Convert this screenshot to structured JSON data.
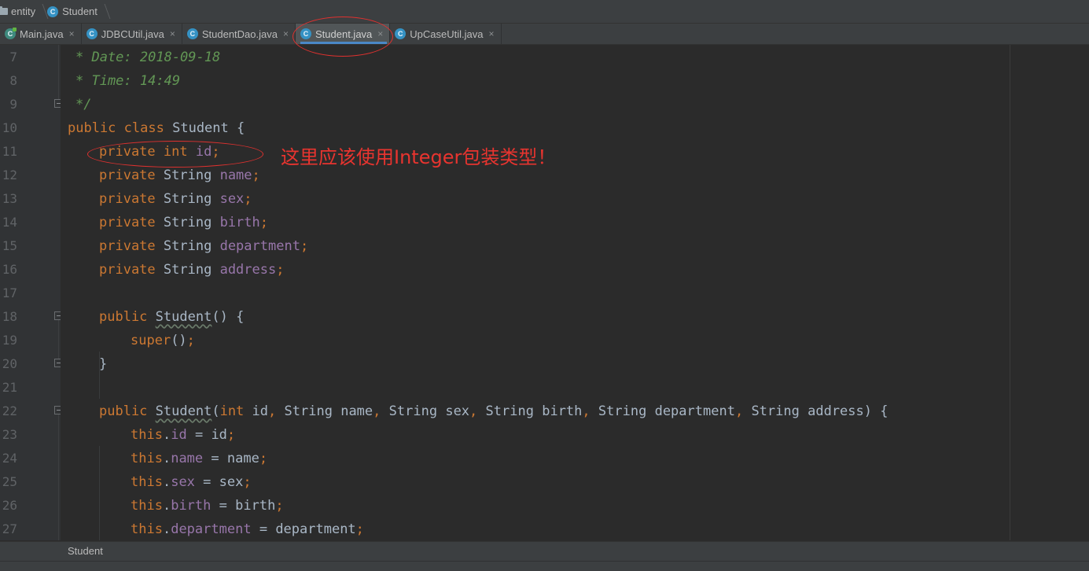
{
  "breadcrumb": {
    "folder": "entity",
    "file": "Student"
  },
  "tabs": [
    {
      "label": "Main.java"
    },
    {
      "label": "JDBCUtil.java"
    },
    {
      "label": "StudentDao.java"
    },
    {
      "label": "Student.java"
    },
    {
      "label": "UpCaseUtil.java"
    }
  ],
  "tab_close": "×",
  "icon_letter": "C",
  "line_numbers": [
    "7",
    "8",
    "9",
    "10",
    "11",
    "12",
    "13",
    "14",
    "15",
    "16",
    "17",
    "18",
    "19",
    "20",
    "21",
    "22",
    "23",
    "24",
    "25",
    "26",
    "27"
  ],
  "code": {
    "l7": "* Date: 2018-09-18",
    "l8": "* Time: 14:49",
    "l9": "*/",
    "public": "public",
    "class": "class",
    "private": "private",
    "int": "int",
    "String": "String",
    "super": "super",
    "this": "this",
    "class_name": "Student",
    "fields": [
      "id",
      "name",
      "sex",
      "birth",
      "department",
      "address"
    ],
    "params": [
      "id",
      "name",
      "sex",
      "birth",
      "department",
      "address"
    ],
    "open_brace": "{",
    "close_brace": "}",
    "semicolon": ";",
    "dot": ".",
    "comma": ",",
    "equals": "=",
    "parens": "()",
    "lparen": "(",
    "rparen": ")"
  },
  "annotation": "这里应该使用Integer包装类型！",
  "status": {
    "label": "Student"
  },
  "colors": {
    "keyword": "#cc7832",
    "field": "#9876aa",
    "comment": "#629755",
    "identifier": "#a9b7c6",
    "annotation": "#e8342f",
    "active_tab_underline": "#4a88c7"
  }
}
